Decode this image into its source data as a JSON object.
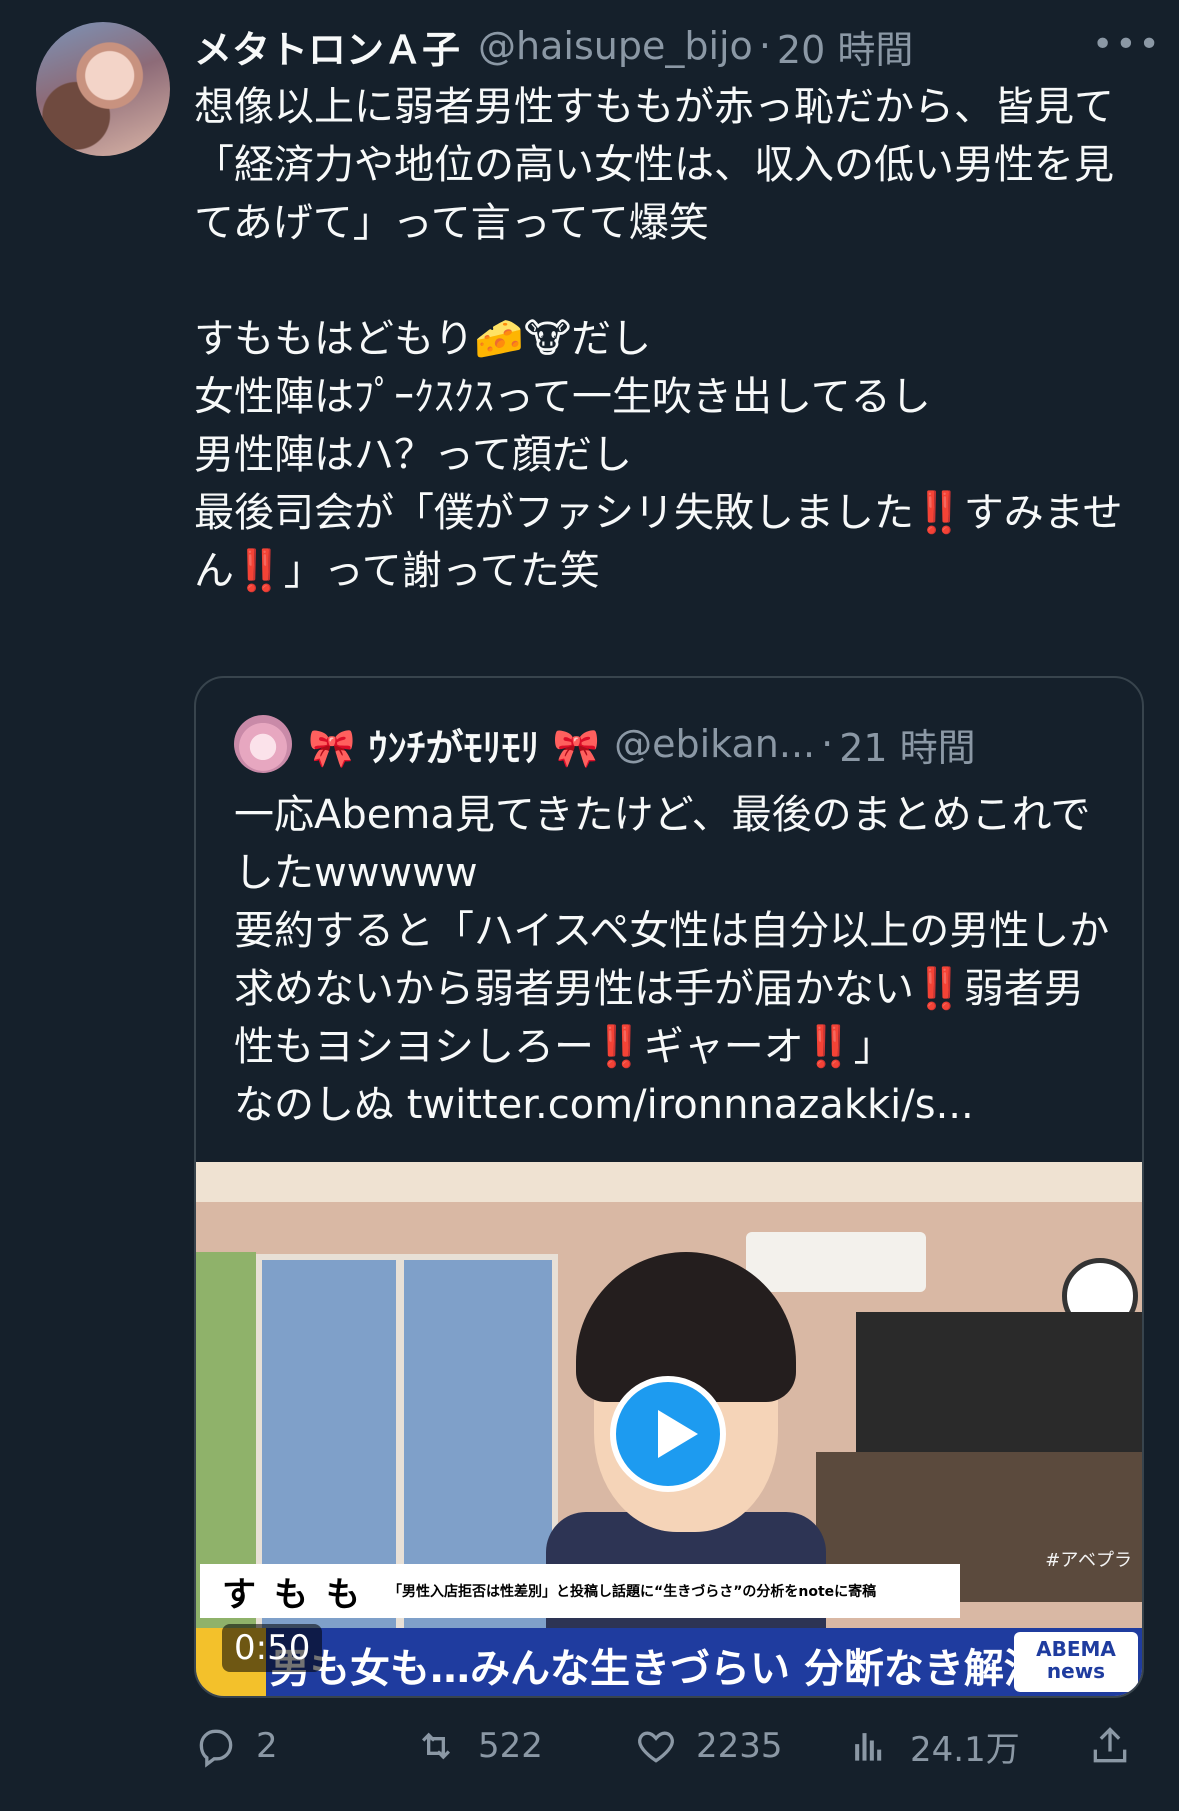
{
  "tweet": {
    "display_name": "メタトロンＡ子",
    "handle": "@haisupe_bijo",
    "separator": "·",
    "time": "20 時間",
    "more": "•••",
    "text": "想像以上に弱者男性すももが赤っ恥だから、皆見て\n「経済力や地位の高い女性は、収入の低い男性を見てあげて」って言ってて爆笑\n\nすももはどもり🧀🐮だし\n女性陣はﾌﾟｰｸｽｸｽって一生吹き出してるし\n男性陣はハ？って顔だし\n最後司会が「僕がファシリ失敗しました‼️すみません‼️」って謝ってた笑"
  },
  "quote": {
    "display_name": "🎀 ｳﾝﾁがﾓﾘﾓﾘ 🎀",
    "handle": "@ebikan...",
    "separator": "·",
    "time": "21 時間",
    "text": "一応Abema見てきたけど、最後のまとめこれでしたwwwww\n要約すると「ハイスペ女性は自分以上の男性しか求めないから弱者男性は手が届かない‼️弱者男性もヨシヨシしろー‼️ギャーオ‼️」\nなのしぬ twitter.com/ironnnazakki/s...",
    "media": {
      "caption_name": "すもも",
      "caption_sub": "「男性入店拒否は性差別」と投稿し話題に“生きづらさ”の分析をnoteに寄稿",
      "bottom_text": "男も女も…みんな生きづらい 分断なき解消法",
      "tag": "#アベプラ",
      "abema_logo": "ABEMA news",
      "duration": "0:50"
    }
  },
  "actions": {
    "replies": "2",
    "retweets": "522",
    "likes": "2235",
    "views": "24.1万"
  },
  "icons": [
    "reply-icon",
    "retweet-icon",
    "like-icon",
    "views-icon",
    "share-icon",
    "more-icon",
    "play-icon"
  ]
}
